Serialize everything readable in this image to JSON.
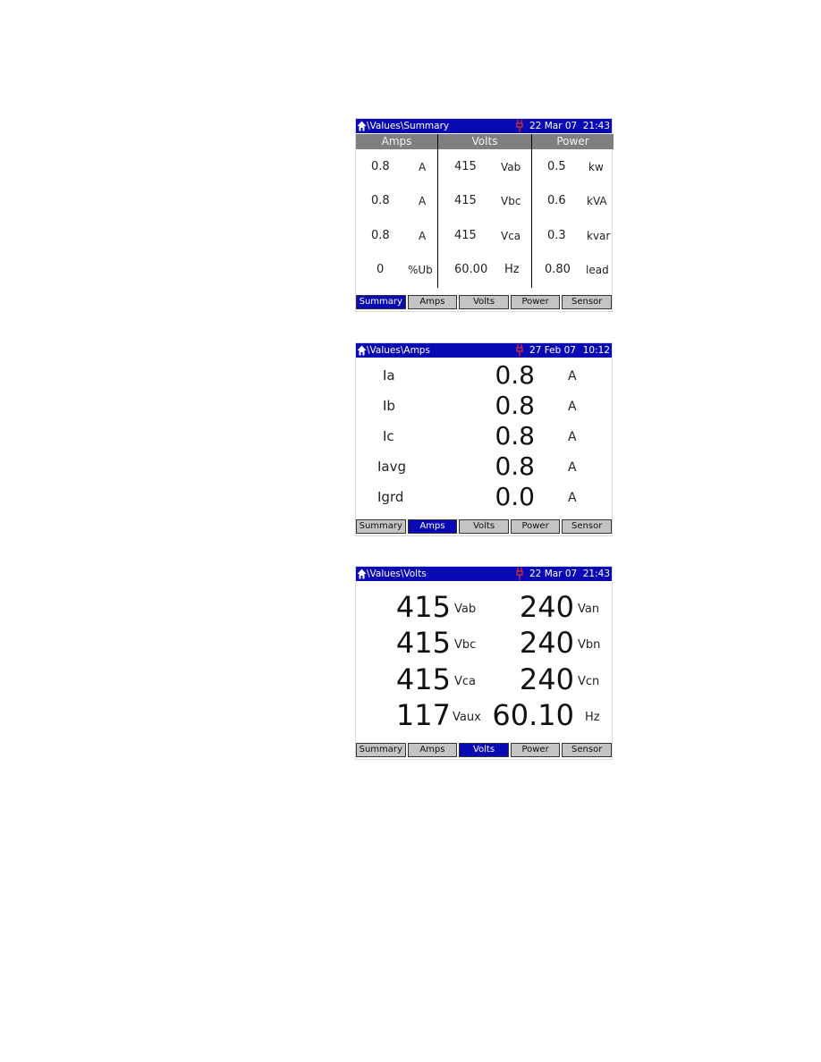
{
  "colors": {
    "header_bg": "#0a0ab4",
    "tab_active_bg": "#0a0ab4",
    "tab_bg": "#c4c4c4",
    "column_header_bg": "#7f7f7f",
    "plug_icon": "#e0302a"
  },
  "tabs": [
    "Summary",
    "Amps",
    "Volts",
    "Power",
    "Sensor"
  ],
  "summary": {
    "header": {
      "home_icon": "home-icon",
      "path": "\\Values\\Summary",
      "status_icon": "plug-icon",
      "date": "22 Mar 07",
      "time": "21:43"
    },
    "active_tab": "Summary",
    "columns": [
      "Amps",
      "Volts",
      "Power"
    ],
    "rows": [
      {
        "amps": "0.8",
        "amps_unit": "A",
        "volts": "415",
        "volts_unit": "Vab",
        "power": "0.5",
        "power_unit": "kw"
      },
      {
        "amps": "0.8",
        "amps_unit": "A",
        "volts": "415",
        "volts_unit": "Vbc",
        "power": "0.6",
        "power_unit": "kVA"
      },
      {
        "amps": "0.8",
        "amps_unit": "A",
        "volts": "415",
        "volts_unit": "Vca",
        "power": "0.3",
        "power_unit": "kvar"
      },
      {
        "amps": "0",
        "amps_unit": "%Ub",
        "volts": "60.00",
        "volts_unit": "Hz",
        "power": "0.80",
        "power_unit": "lead"
      }
    ]
  },
  "amps": {
    "header": {
      "home_icon": "home-icon",
      "path": "\\Values\\Amps",
      "status_icon": "plug-icon",
      "date": "27 Feb 07",
      "time": "10:12"
    },
    "active_tab": "Amps",
    "rows": [
      {
        "label": "Ia",
        "value": "0.8",
        "unit": "A"
      },
      {
        "label": "Ib",
        "value": "0.8",
        "unit": "A"
      },
      {
        "label": "Ic",
        "value": "0.8",
        "unit": "A"
      },
      {
        "label": "Iavg",
        "value": "0.8",
        "unit": "A"
      },
      {
        "label": "Igrd",
        "value": "0.0",
        "unit": "A"
      }
    ]
  },
  "volts": {
    "header": {
      "home_icon": "home-icon",
      "path": "\\Values\\Volts",
      "status_icon": "plug-icon",
      "date": "22 Mar 07",
      "time": "21:43"
    },
    "active_tab": "Volts",
    "rows": [
      {
        "left_value": "415",
        "left_unit": "Vab",
        "right_value": "240",
        "right_unit": "Van"
      },
      {
        "left_value": "415",
        "left_unit": "Vbc",
        "right_value": "240",
        "right_unit": "Vbn"
      },
      {
        "left_value": "415",
        "left_unit": "Vca",
        "right_value": "240",
        "right_unit": "Vcn"
      },
      {
        "left_value": "117",
        "left_unit": "Vaux",
        "right_value": "60.10",
        "right_unit": "Hz"
      }
    ]
  }
}
